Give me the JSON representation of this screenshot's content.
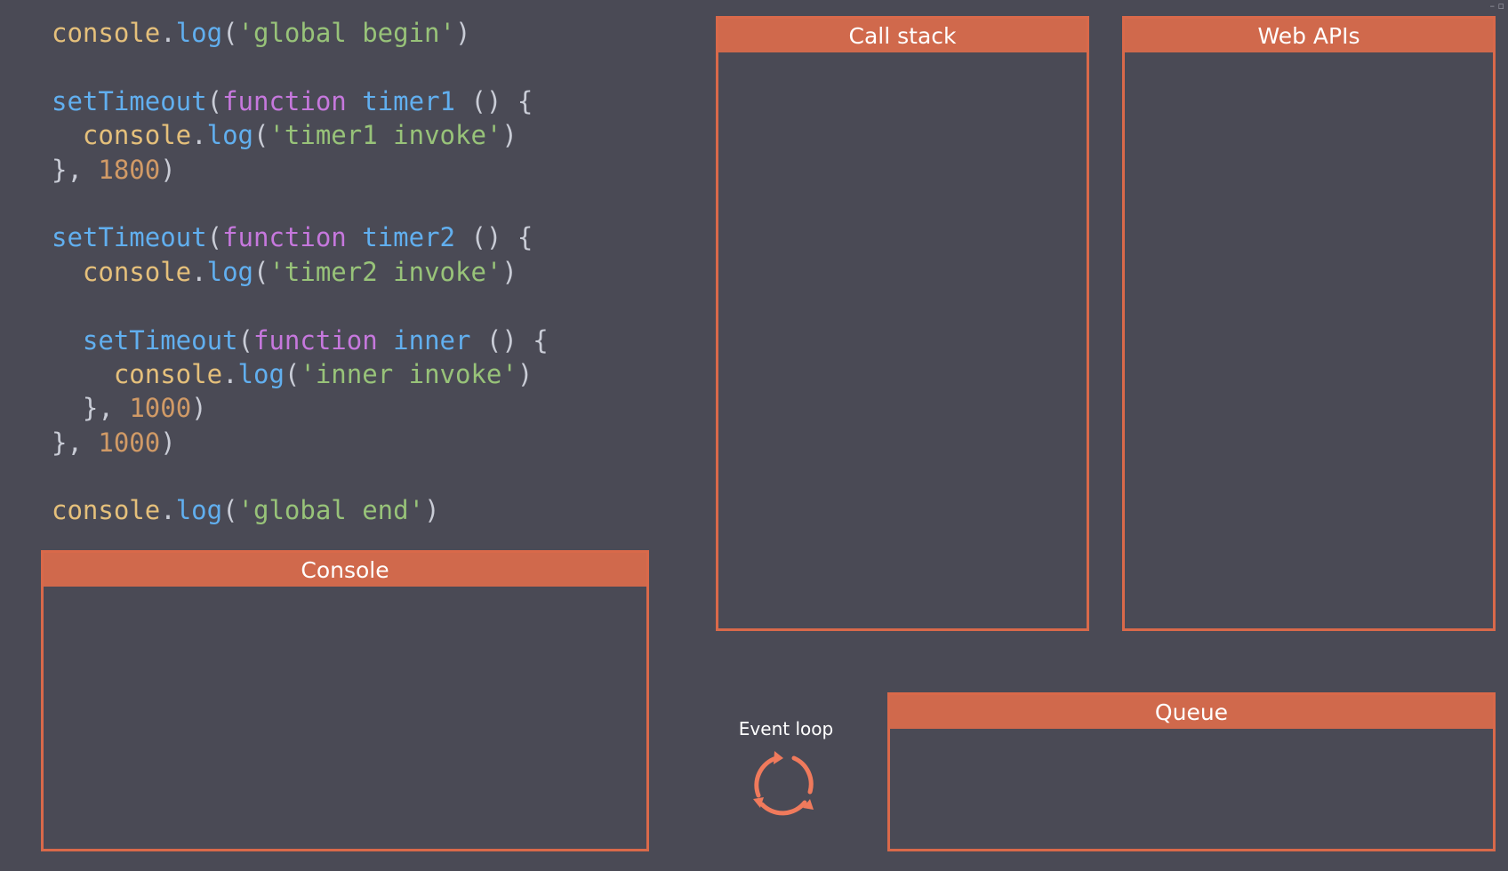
{
  "code": {
    "lines": [
      [
        {
          "t": "console",
          "c": "obj"
        },
        {
          "t": ".",
          "c": "punc"
        },
        {
          "t": "log",
          "c": "fn"
        },
        {
          "t": "(",
          "c": "punc"
        },
        {
          "t": "'global begin'",
          "c": "str"
        },
        {
          "t": ")",
          "c": "punc"
        }
      ],
      [],
      [
        {
          "t": "setTimeout",
          "c": "fn"
        },
        {
          "t": "(",
          "c": "punc"
        },
        {
          "t": "function",
          "c": "kw"
        },
        {
          "t": " ",
          "c": "punc"
        },
        {
          "t": "timer1",
          "c": "fn"
        },
        {
          "t": " () {",
          "c": "punc"
        }
      ],
      [
        {
          "t": "  ",
          "c": "punc"
        },
        {
          "t": "console",
          "c": "obj"
        },
        {
          "t": ".",
          "c": "punc"
        },
        {
          "t": "log",
          "c": "fn"
        },
        {
          "t": "(",
          "c": "punc"
        },
        {
          "t": "'timer1 invoke'",
          "c": "str"
        },
        {
          "t": ")",
          "c": "punc"
        }
      ],
      [
        {
          "t": "}, ",
          "c": "punc"
        },
        {
          "t": "1800",
          "c": "num"
        },
        {
          "t": ")",
          "c": "punc"
        }
      ],
      [],
      [
        {
          "t": "setTimeout",
          "c": "fn"
        },
        {
          "t": "(",
          "c": "punc"
        },
        {
          "t": "function",
          "c": "kw"
        },
        {
          "t": " ",
          "c": "punc"
        },
        {
          "t": "timer2",
          "c": "fn"
        },
        {
          "t": " () {",
          "c": "punc"
        }
      ],
      [
        {
          "t": "  ",
          "c": "punc"
        },
        {
          "t": "console",
          "c": "obj"
        },
        {
          "t": ".",
          "c": "punc"
        },
        {
          "t": "log",
          "c": "fn"
        },
        {
          "t": "(",
          "c": "punc"
        },
        {
          "t": "'timer2 invoke'",
          "c": "str"
        },
        {
          "t": ")",
          "c": "punc"
        }
      ],
      [],
      [
        {
          "t": "  ",
          "c": "punc"
        },
        {
          "t": "setTimeout",
          "c": "fn"
        },
        {
          "t": "(",
          "c": "punc"
        },
        {
          "t": "function",
          "c": "kw"
        },
        {
          "t": " ",
          "c": "punc"
        },
        {
          "t": "inner",
          "c": "fn"
        },
        {
          "t": " () {",
          "c": "punc"
        }
      ],
      [
        {
          "t": "    ",
          "c": "punc"
        },
        {
          "t": "console",
          "c": "obj"
        },
        {
          "t": ".",
          "c": "punc"
        },
        {
          "t": "log",
          "c": "fn"
        },
        {
          "t": "(",
          "c": "punc"
        },
        {
          "t": "'inner invoke'",
          "c": "str"
        },
        {
          "t": ")",
          "c": "punc"
        }
      ],
      [
        {
          "t": "  }, ",
          "c": "punc"
        },
        {
          "t": "1000",
          "c": "num"
        },
        {
          "t": ")",
          "c": "punc"
        }
      ],
      [
        {
          "t": "}, ",
          "c": "punc"
        },
        {
          "t": "1000",
          "c": "num"
        },
        {
          "t": ")",
          "c": "punc"
        }
      ],
      [],
      [
        {
          "t": "console",
          "c": "obj"
        },
        {
          "t": ".",
          "c": "punc"
        },
        {
          "t": "log",
          "c": "fn"
        },
        {
          "t": "(",
          "c": "punc"
        },
        {
          "t": "'global end'",
          "c": "str"
        },
        {
          "t": ")",
          "c": "punc"
        }
      ]
    ]
  },
  "panels": {
    "console": {
      "title": "Console"
    },
    "call_stack": {
      "title": "Call stack"
    },
    "web_apis": {
      "title": "Web APIs"
    },
    "queue": {
      "title": "Queue"
    }
  },
  "event_loop": {
    "label": "Event loop",
    "icon": "refresh-cycle-icon"
  },
  "colors": {
    "background": "#4a4a55",
    "panel_border": "#d9694a",
    "panel_header": "#d0694c",
    "event_loop_icon": "#f07a5c"
  }
}
